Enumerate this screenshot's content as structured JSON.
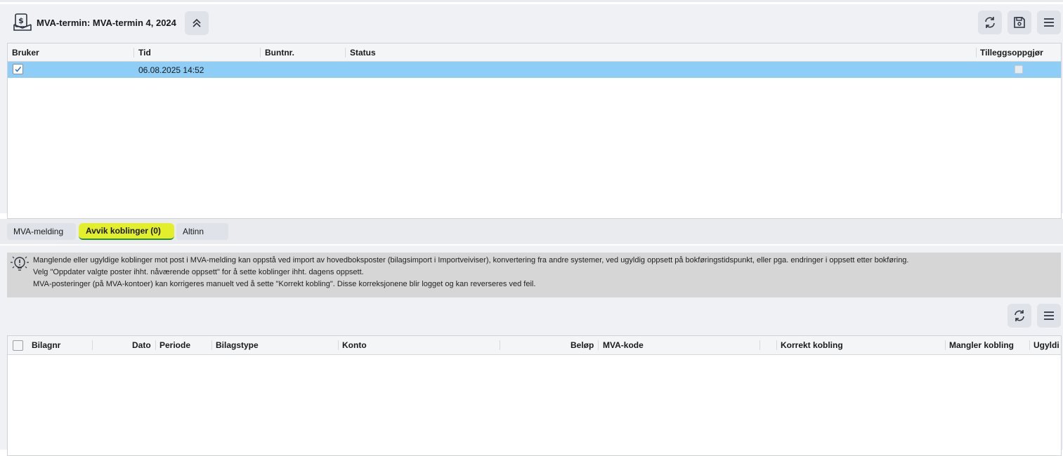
{
  "header": {
    "title": "MVA-termin: MVA-termin 4, 2024",
    "icons": [
      "tax-document-icon",
      "collapse-chevrons-icon",
      "refresh-icon",
      "save-icon",
      "menu-icon"
    ]
  },
  "top_grid": {
    "columns": [
      "Bruker",
      "Tid",
      "Buntnr.",
      "Status",
      "Tilleggsoppgjør"
    ],
    "rows": [
      {
        "bruker_checked": true,
        "tid": "06.08.2025 14:52",
        "buntnr": "",
        "status": "",
        "tilleggsoppgjor_checked": false
      }
    ]
  },
  "tabs": [
    {
      "label": "MVA-melding",
      "active": false
    },
    {
      "label": "Avvik koblinger (0)",
      "active": true
    },
    {
      "label": "Altinn",
      "active": false
    }
  ],
  "info": {
    "icon": "lightbulb-icon",
    "lines": [
      "Manglende eller ugyldige koblinger mot post i MVA-melding kan oppstå ved import av hovedboksposter (bilagsimport i Importveiviser), konvertering fra andre systemer, ved ugyldig oppsett på bokføringstidspunkt, eller pga. endringer i oppsett etter bokføring.",
      "Velg \"Oppdater valgte poster ihht. nåværende oppsett\" for å sette koblinger ihht. dagens oppsett.",
      "MVA-posteringer (på MVA-kontoer) kan korrigeres manuelt ved å sette \"Korrekt kobling\". Disse korreksjonene blir logget og kan reverseres ved feil."
    ]
  },
  "bottom_grid": {
    "columns": [
      "Bilagnr",
      "Dato",
      "Periode",
      "Bilagstype",
      "Konto",
      "Beløp",
      "MVA-kode",
      "Korrekt kobling",
      "Mangler kobling",
      "Ugyldi"
    ]
  },
  "colors": {
    "selected_row": "#8dcdf6",
    "active_tab": "#e3ef2a",
    "active_tab_underline": "#2e8b3a",
    "info_bg": "#d6d6d6"
  }
}
